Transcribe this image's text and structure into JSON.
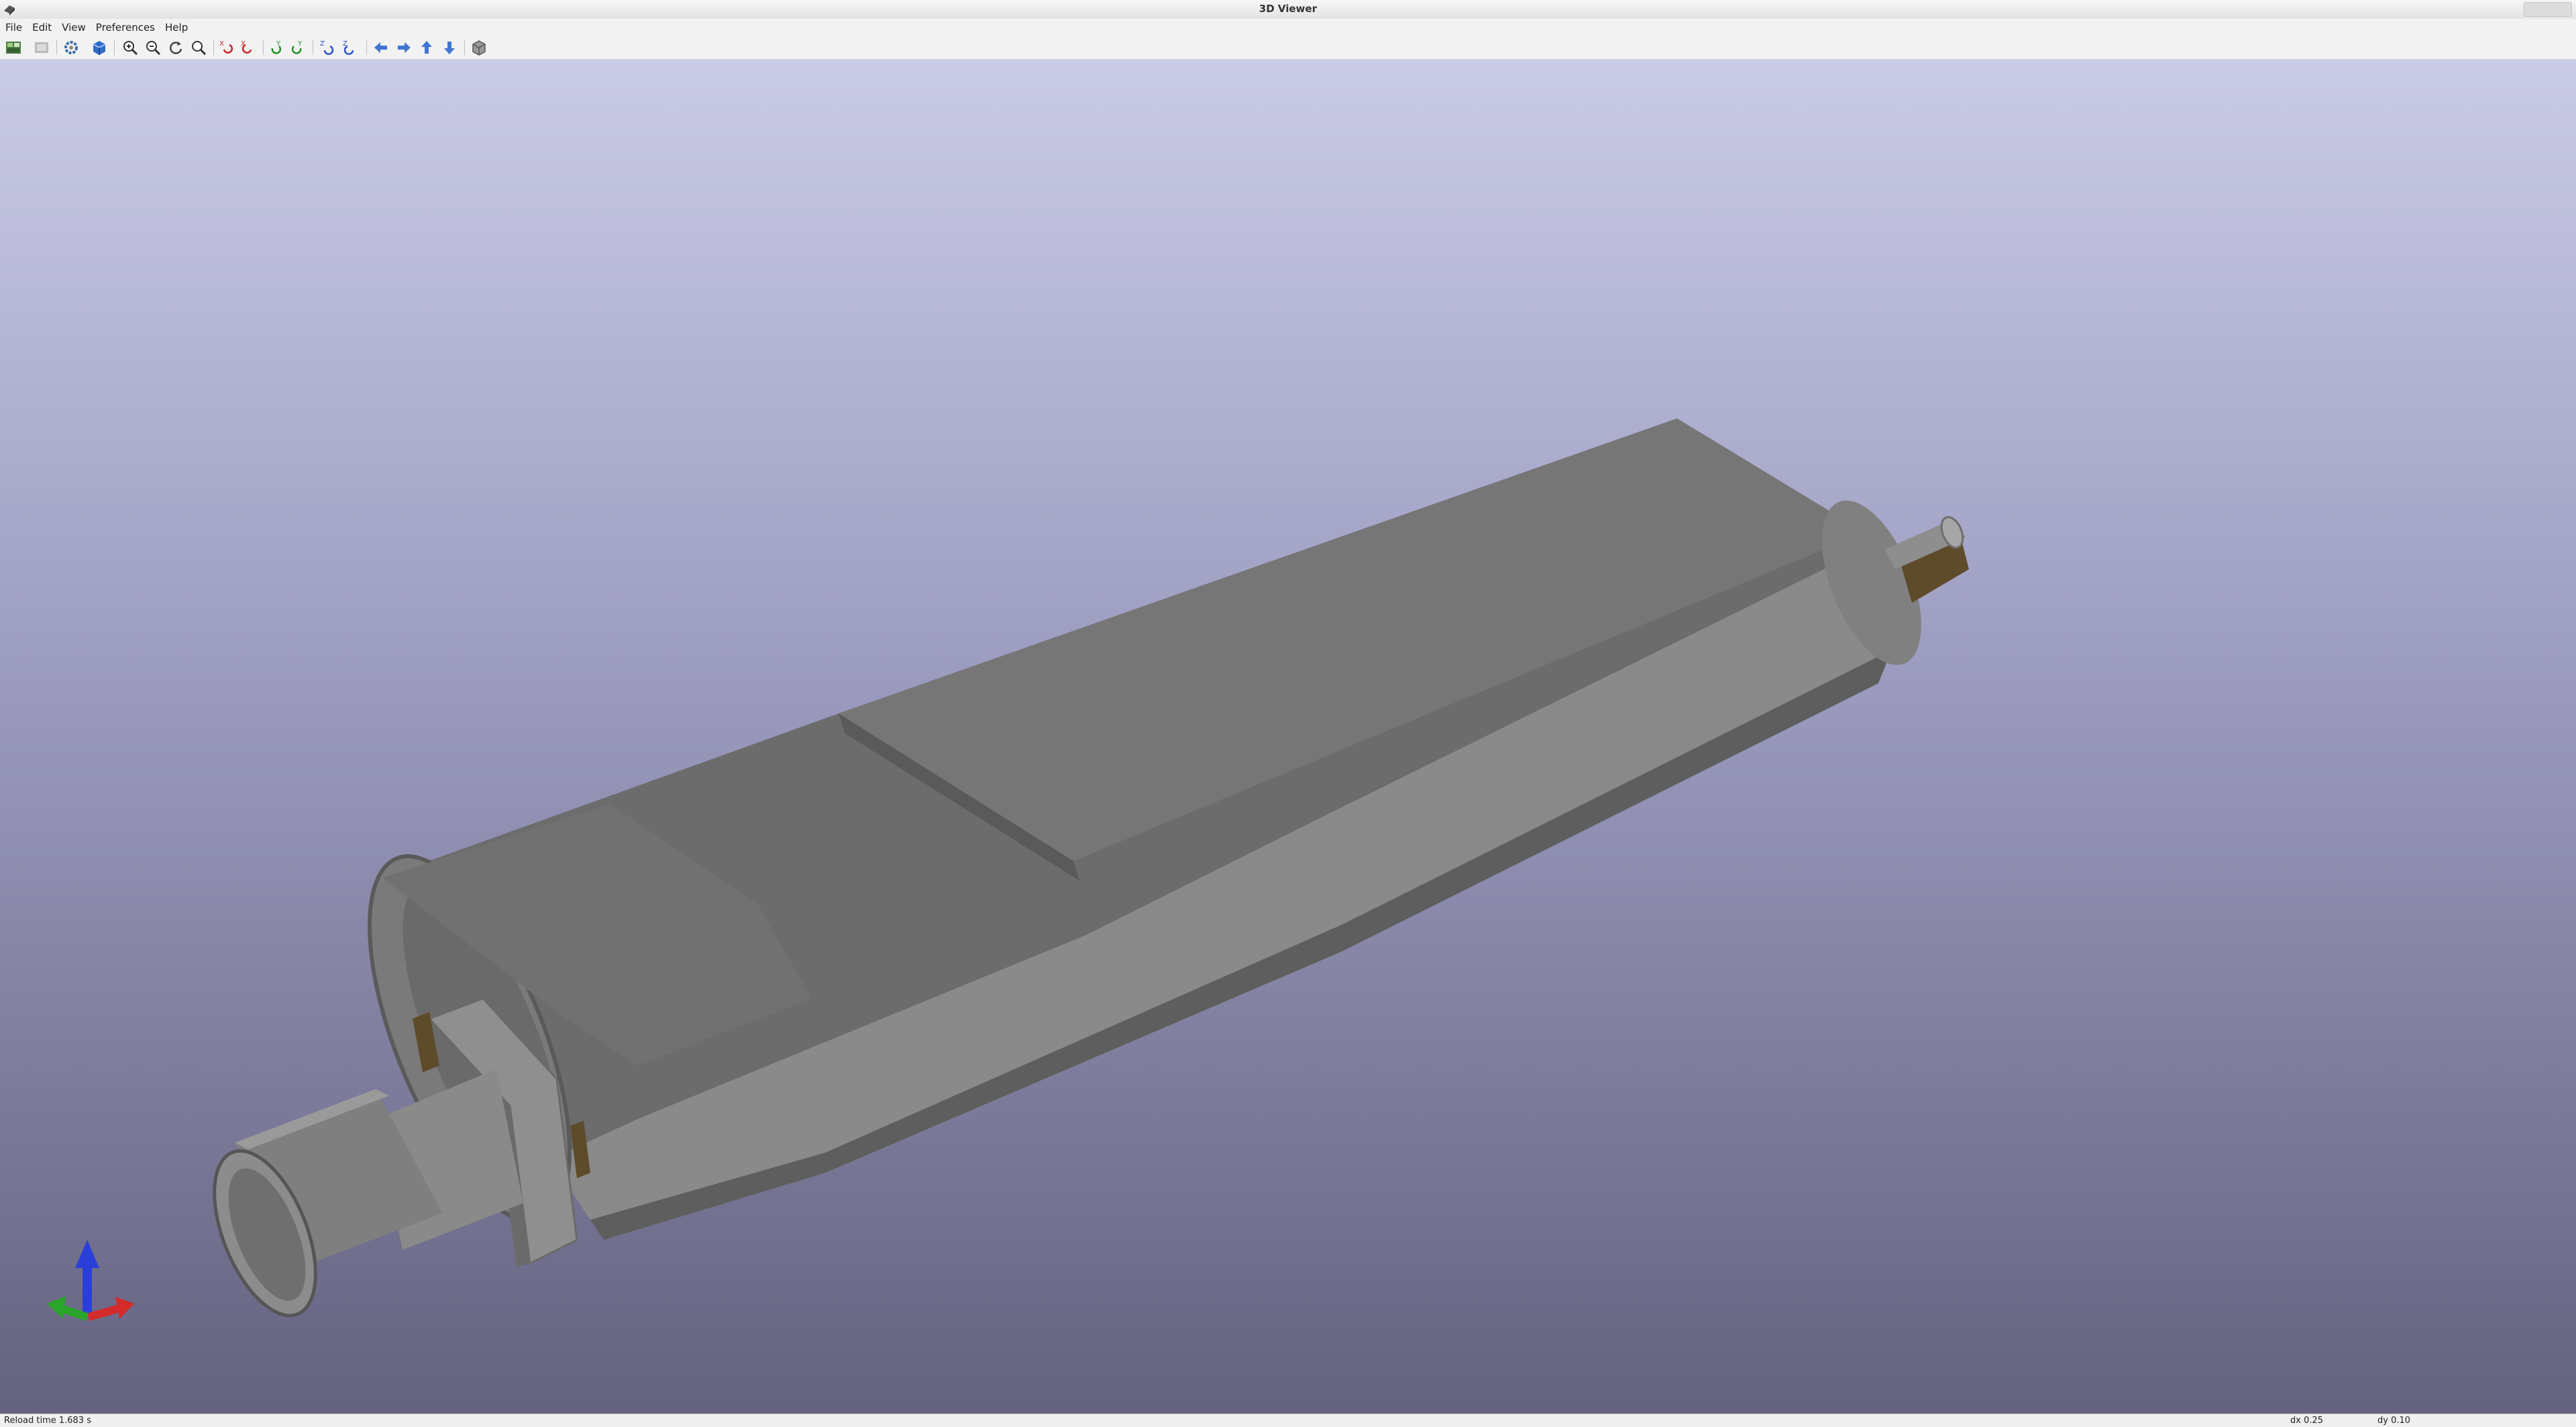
{
  "window": {
    "title": "3D Viewer"
  },
  "menu": {
    "items": [
      "File",
      "Edit",
      "View",
      "Preferences",
      "Help"
    ]
  },
  "toolbar": {
    "icons": [
      "render-options-icon",
      "raytrace-icon",
      "preferences-icon",
      "material-icon",
      "zoom-in-icon",
      "zoom-out-icon",
      "redraw-icon",
      "zoom-fit-icon",
      "rotate-x-cw-icon",
      "rotate-x-ccw-icon",
      "rotate-y-cw-icon",
      "rotate-y-ccw-icon",
      "rotate-z-cw-icon",
      "rotate-z-ccw-icon",
      "move-left-icon",
      "move-right-icon",
      "move-up-icon",
      "move-down-icon",
      "orthographic-icon"
    ]
  },
  "colors": {
    "axis_x": "#d42a2a",
    "axis_y": "#2aa42a",
    "axis_z": "#2a3fd8",
    "model_gray": "#7b7b7b",
    "connector_brown": "#5d4b2a"
  },
  "status": {
    "message": "Reload time 1.683 s",
    "dx": "dx 0.25",
    "dy": "dy 0.10"
  }
}
